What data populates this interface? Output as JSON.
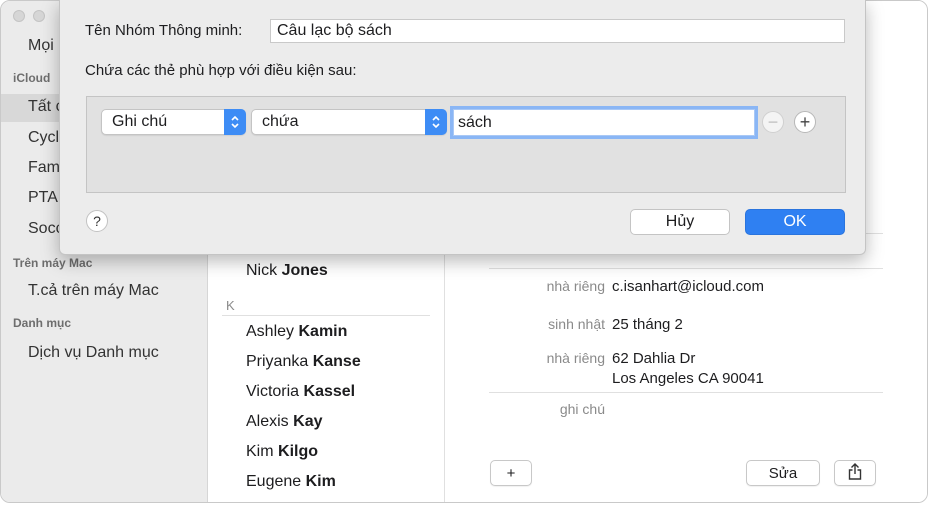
{
  "sidebar": {
    "items": [
      {
        "label": "Mọi liên hệ"
      },
      {
        "label": "Tất cả iCloud"
      },
      {
        "label": "Cycling"
      },
      {
        "label": "Family"
      },
      {
        "label": "PTA"
      },
      {
        "label": "Soccer"
      },
      {
        "label": "T.cả trên máy Mac"
      },
      {
        "label": "Dịch vụ Danh mục"
      }
    ],
    "headers": [
      "iCloud",
      "Trên máy Mac",
      "Danh mục"
    ]
  },
  "list": {
    "letter": "K",
    "contacts": [
      {
        "first": "Nick",
        "last": "Jones"
      },
      {
        "first": "Ashley",
        "last": "Kamin"
      },
      {
        "first": "Priyanka",
        "last": "Kanse"
      },
      {
        "first": "Victoria",
        "last": "Kassel"
      },
      {
        "first": "Alexis",
        "last": "Kay"
      },
      {
        "first": "Kim",
        "last": "Kilgo"
      },
      {
        "first": "Eugene",
        "last": "Kim"
      }
    ]
  },
  "detail": {
    "fields": [
      {
        "label": "nhà riêng",
        "value": "c.isanhart@icloud.com"
      },
      {
        "label": "sinh nhật",
        "value": "25 tháng 2"
      },
      {
        "label": "nhà riêng",
        "value_line1": "62 Dahlia Dr",
        "value_line2": "Los Angeles CA 90041"
      },
      {
        "label": "ghi chú",
        "value": ""
      }
    ],
    "add_button": "+",
    "edit_button": "Sửa"
  },
  "sheet": {
    "name_label": "Tên Nhóm Thông minh:",
    "name_value": "Câu lạc bộ sách",
    "condition_label": "Chứa các thẻ phù hợp với điều kiện sau:",
    "rule": {
      "field": "Ghi chú",
      "operator": "chứa",
      "value": "sách"
    },
    "help": "?",
    "cancel": "Hủy",
    "ok": "OK"
  },
  "colors": {
    "accent": "#2f80f2",
    "sidebar_bg": "#ebebeb",
    "sheet_bg": "#ececec"
  }
}
